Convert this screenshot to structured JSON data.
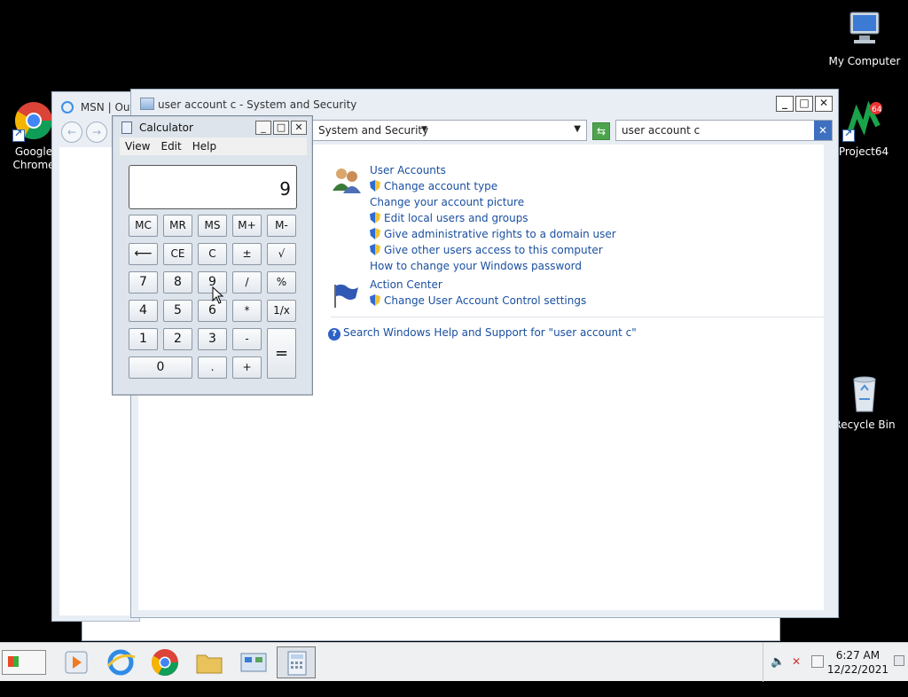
{
  "desktop": {
    "icons": [
      {
        "label": "My Computer"
      },
      {
        "label": "Google Chrome"
      },
      {
        "label": "Project64"
      },
      {
        "label": "Recycle Bin"
      }
    ]
  },
  "msn_window": {
    "title": "MSN | Outl"
  },
  "explorer": {
    "title": "user account c - System and Security",
    "address": "System and Security",
    "search_value": "user account c",
    "results": {
      "user_accounts": {
        "heading": "User Accounts",
        "links": [
          "Change account type",
          "Change your account picture",
          "Edit local users and groups",
          "Give administrative rights to a domain user",
          "Give other users access to this computer",
          "How to change your Windows password"
        ]
      },
      "action_center": {
        "heading": "Action Center",
        "links": [
          "Change User Account Control settings"
        ]
      },
      "help_link": "Search Windows Help and Support for \"user account c\""
    }
  },
  "calculator": {
    "title": "Calculator",
    "menu": [
      "View",
      "Edit",
      "Help"
    ],
    "display": "9",
    "keys": {
      "mc": "MC",
      "mr": "MR",
      "ms": "MS",
      "mplus": "M+",
      "mminus": "M-",
      "back": "⟵",
      "ce": "CE",
      "c": "C",
      "pm": "±",
      "sqrt": "√",
      "n7": "7",
      "n8": "8",
      "n9": "9",
      "div": "/",
      "pct": "%",
      "n4": "4",
      "n5": "5",
      "n6": "6",
      "mul": "*",
      "recip": "1/x",
      "n1": "1",
      "n2": "2",
      "n3": "3",
      "sub": "-",
      "eq": "=",
      "n0": "0",
      "dot": ".",
      "add": "+"
    }
  },
  "taskbar": {
    "start_label": "Start",
    "time": "6:27 AM",
    "date": "12/22/2021"
  }
}
